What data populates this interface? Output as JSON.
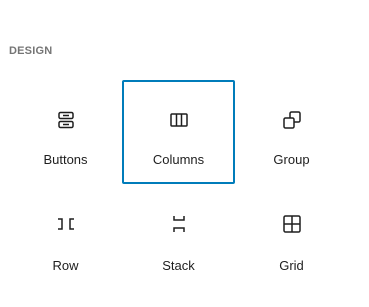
{
  "section": {
    "title": "DESIGN"
  },
  "blocks": [
    {
      "label": "Buttons",
      "icon": "buttons-icon"
    },
    {
      "label": "Columns",
      "icon": "columns-icon",
      "selected": true
    },
    {
      "label": "Group",
      "icon": "group-icon"
    },
    {
      "label": "Row",
      "icon": "row-icon"
    },
    {
      "label": "Stack",
      "icon": "stack-icon"
    },
    {
      "label": "Grid",
      "icon": "grid-icon"
    }
  ],
  "colors": {
    "selection_border": "#007cba",
    "section_title": "#757575",
    "text": "#1e1e1e"
  }
}
